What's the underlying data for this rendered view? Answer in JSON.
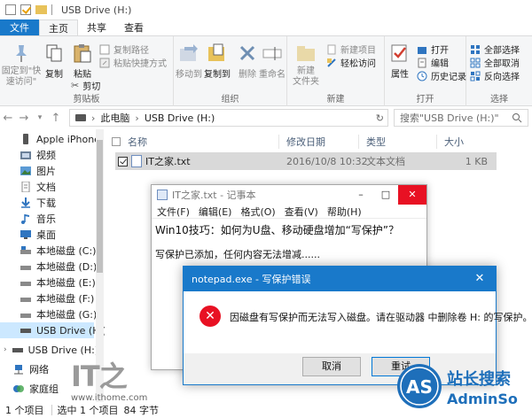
{
  "window": {
    "title": "USB Drive (H:)",
    "qat_separator": "|"
  },
  "ribbon": {
    "tabs": [
      "文件",
      "主页",
      "共享",
      "查看"
    ],
    "groups": {
      "clipboard": {
        "label": "剪贴板",
        "pin": "固定到\"快速访问\"",
        "copy": "复制",
        "paste": "粘贴",
        "copy_path": "复制路径",
        "paste_shortcut": "粘贴快捷方式",
        "cut": "剪切"
      },
      "organize": {
        "label": "组织",
        "move_to": "移动到",
        "copy_to": "复制到",
        "delete": "删除",
        "rename": "重命名"
      },
      "new": {
        "label": "新建",
        "new_folder": "新建\n文件夹",
        "new_item": "新建项目",
        "easy_access": "轻松访问"
      },
      "open": {
        "label": "打开",
        "properties": "属性",
        "open": "打开",
        "edit": "编辑",
        "history": "历史记录"
      },
      "select": {
        "label": "选择",
        "select_all": "全部选择",
        "select_none": "全部取消",
        "invert": "反向选择"
      }
    }
  },
  "address": {
    "this_pc": "此电脑",
    "drive": "USB Drive (H:)",
    "search_placeholder": "搜索\"USB Drive (H:)\""
  },
  "nav": {
    "items": [
      {
        "label": "Apple iPhone"
      },
      {
        "label": "视频"
      },
      {
        "label": "图片"
      },
      {
        "label": "文档"
      },
      {
        "label": "下载"
      },
      {
        "label": "音乐"
      },
      {
        "label": "桌面"
      },
      {
        "label": "本地磁盘 (C:)"
      },
      {
        "label": "本地磁盘 (D:)"
      },
      {
        "label": "本地磁盘 (E:)"
      },
      {
        "label": "本地磁盘 (F:)"
      },
      {
        "label": "本地磁盘 (G:)"
      },
      {
        "label": "USB Drive (H:)"
      },
      {
        "label": "USB Drive (H:)"
      },
      {
        "label": "网络"
      },
      {
        "label": "家庭组"
      }
    ]
  },
  "filelist": {
    "columns": [
      "名称",
      "修改日期",
      "类型",
      "大小"
    ],
    "rows": [
      {
        "name": "IT之家.txt",
        "modified": "2016/10/8 10:32",
        "type": "文本文档",
        "size": "1 KB"
      }
    ]
  },
  "status": {
    "count": "1 个项目",
    "selected": "选中 1 个项目",
    "size": "84 字节"
  },
  "notepad": {
    "title": "IT之家.txt - 记事本",
    "menu": [
      "文件(F)",
      "编辑(E)",
      "格式(O)",
      "查看(V)",
      "帮助(H)"
    ],
    "line1": "Win10技巧：如何为U盘、移动硬盘增加“写保护”？",
    "line2": "写保护已添加，任何内容无法增减......"
  },
  "dialog": {
    "title": "notepad.exe - 写保护错误",
    "message": "因磁盘有写保护而无法写入磁盘。请在驱动器 中删除卷 H: 的写保护。",
    "cancel": "取消",
    "retry": "重试"
  },
  "watermarks": {
    "ithome_big": "IT之",
    "ithome_url": "www.ithome.com",
    "site_cn": "站长搜索",
    "site_en": "AdminSo",
    "logo_letters": "AS"
  },
  "colors": {
    "accent": "#1979ca",
    "selection": "#cce8ff",
    "close_red": "#e81123"
  }
}
